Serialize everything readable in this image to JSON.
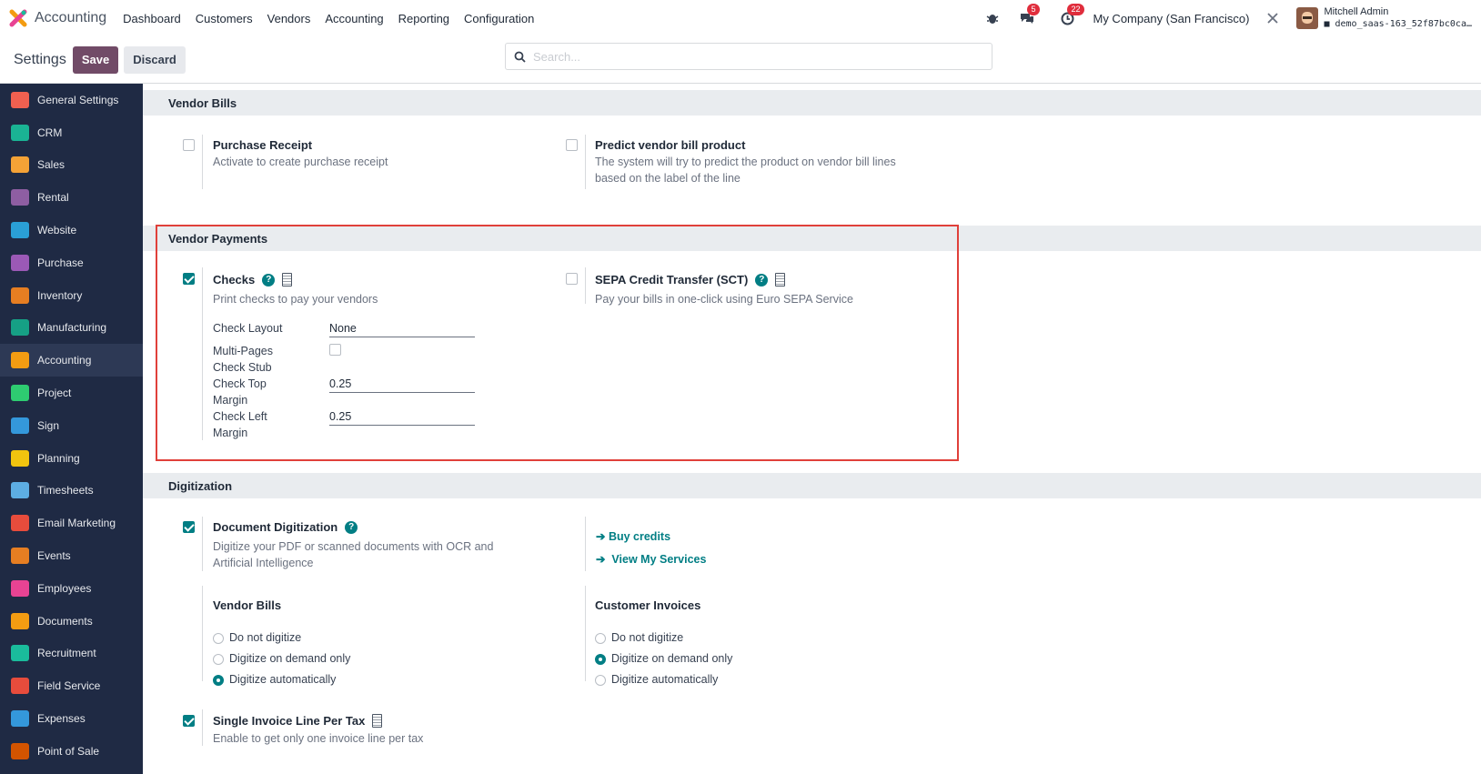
{
  "topbar": {
    "app_name": "Accounting",
    "menu": [
      "Dashboard",
      "Customers",
      "Vendors",
      "Accounting",
      "Reporting",
      "Configuration"
    ],
    "messages_badge": "5",
    "activities_badge": "22",
    "company": "My Company (San Francisco)",
    "user_name": "Mitchell Admin",
    "database": "demo_saas-163_52f87bc0ca…"
  },
  "controlbar": {
    "breadcrumb": "Settings",
    "save_label": "Save",
    "discard_label": "Discard",
    "search_placeholder": "Search..."
  },
  "sidebar": {
    "items": [
      {
        "label": "General Settings",
        "color": "#f06050"
      },
      {
        "label": "CRM",
        "color": "#1ab394"
      },
      {
        "label": "Sales",
        "color": "#f4a236"
      },
      {
        "label": "Rental",
        "color": "#8e5ea2"
      },
      {
        "label": "Website",
        "color": "#2a9fd6"
      },
      {
        "label": "Purchase",
        "color": "#9b59b6"
      },
      {
        "label": "Inventory",
        "color": "#e67e22"
      },
      {
        "label": "Manufacturing",
        "color": "#16a085"
      },
      {
        "label": "Accounting",
        "color": "#f39c12"
      },
      {
        "label": "Project",
        "color": "#2ecc71"
      },
      {
        "label": "Sign",
        "color": "#3498db"
      },
      {
        "label": "Planning",
        "color": "#f1c40f"
      },
      {
        "label": "Timesheets",
        "color": "#5dade2"
      },
      {
        "label": "Email Marketing",
        "color": "#e74c3c"
      },
      {
        "label": "Events",
        "color": "#e67e22"
      },
      {
        "label": "Employees",
        "color": "#e84393"
      },
      {
        "label": "Documents",
        "color": "#f39c12"
      },
      {
        "label": "Recruitment",
        "color": "#1abc9c"
      },
      {
        "label": "Field Service",
        "color": "#e74c3c"
      },
      {
        "label": "Expenses",
        "color": "#3498db"
      },
      {
        "label": "Point of Sale",
        "color": "#d35400"
      }
    ],
    "active": "Accounting"
  },
  "vendor_bills_section": {
    "heading": "Vendor Bills",
    "purchase_receipt": {
      "title": "Purchase Receipt",
      "desc": "Activate to create purchase receipt",
      "checked": false
    },
    "predict_product": {
      "title": "Predict vendor bill product",
      "desc_1": "The system will try to predict the product on vendor bill lines",
      "desc_2": "based on the label of the line",
      "checked": false
    }
  },
  "vendor_payments_section": {
    "heading": "Vendor Payments",
    "checks": {
      "title": "Checks",
      "desc": "Print checks to pay your vendors",
      "checked": true,
      "layout_label": "Check Layout",
      "layout_value": "None",
      "multipages_label_1": "Multi-Pages",
      "multipages_label_2": "Check Stub",
      "top_margin_label_1": "Check Top",
      "top_margin_label_2": "Margin",
      "top_margin_value": "0.25",
      "left_margin_label_1": "Check Left",
      "left_margin_label_2": "Margin",
      "left_margin_value": "0.25"
    },
    "sepa": {
      "title": "SEPA Credit Transfer (SCT)",
      "desc": "Pay your bills in one-click using Euro SEPA Service",
      "checked": false
    }
  },
  "digitization_section": {
    "heading": "Digitization",
    "doc_digitization": {
      "title": "Document Digitization",
      "desc_1": "Digitize your PDF or scanned documents with OCR and",
      "desc_2": "Artificial Intelligence",
      "checked": true
    },
    "buy_credits": "Buy credits",
    "view_services": "View My Services",
    "vendor_bills": {
      "title": "Vendor Bills",
      "options": [
        "Do not digitize",
        "Digitize on demand only",
        "Digitize automatically"
      ],
      "selected": "Digitize automatically"
    },
    "customer_invoices": {
      "title": "Customer Invoices",
      "options": [
        "Do not digitize",
        "Digitize on demand only",
        "Digitize automatically"
      ],
      "selected": "Digitize on demand only"
    },
    "single_line": {
      "title": "Single Invoice Line Per Tax",
      "desc": "Enable to get only one invoice line per tax",
      "checked": true
    }
  },
  "colors": {
    "primary": "#714b67",
    "accent": "#017e84",
    "sidebar_bg": "#1f2a44",
    "highlight": "#e0403a"
  }
}
